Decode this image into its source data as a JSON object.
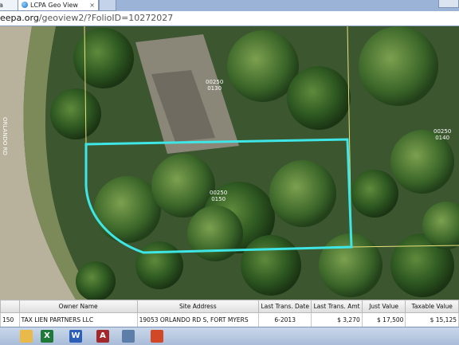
{
  "browser": {
    "tabs": [
      {
        "label": "a"
      },
      {
        "label": "LCPA Geo View",
        "active": true
      },
      {
        "label": ""
      }
    ],
    "url": {
      "host": "eepa.org",
      "path": "/geoview2/?FolioID=10272027"
    }
  },
  "map": {
    "parcel_labels": [
      {
        "line1": "00250",
        "line2": "0130"
      },
      {
        "line1": "00250",
        "line2": "0140"
      },
      {
        "line1": "00250",
        "line2": "0150"
      }
    ],
    "road_label": "ORLANDO RD",
    "colors": {
      "selection_outline": "#3ee6e6",
      "parcel_line": "#e8e27a"
    }
  },
  "results": {
    "columns": [
      "",
      "Owner Name",
      "Site Address",
      "Last Trans. Date",
      "Last Trans. Amt",
      "Just Value",
      "Taxable Value"
    ],
    "rows": [
      [
        "150",
        "TAX LIEN PARTNERS LLC",
        "19053 ORLANDO RD S, FORT MYERS",
        "6-2013",
        "$ 3,270",
        "$ 17,500",
        "$ 15,125"
      ]
    ]
  },
  "taskbar": {
    "apps": [
      {
        "icon": "folder-icon",
        "color": "#e9b949"
      },
      {
        "icon": "excel-icon",
        "letter": "X",
        "color": "#1f7a3a"
      },
      {
        "icon": "word-icon",
        "letter": "W",
        "color": "#2b5fb8"
      },
      {
        "icon": "access-icon",
        "letter": "A",
        "color": "#a3282b"
      },
      {
        "icon": "calculator-icon",
        "color": "#5b7fa8"
      },
      {
        "icon": "powerpoint-icon",
        "color": "#d24726"
      }
    ]
  }
}
